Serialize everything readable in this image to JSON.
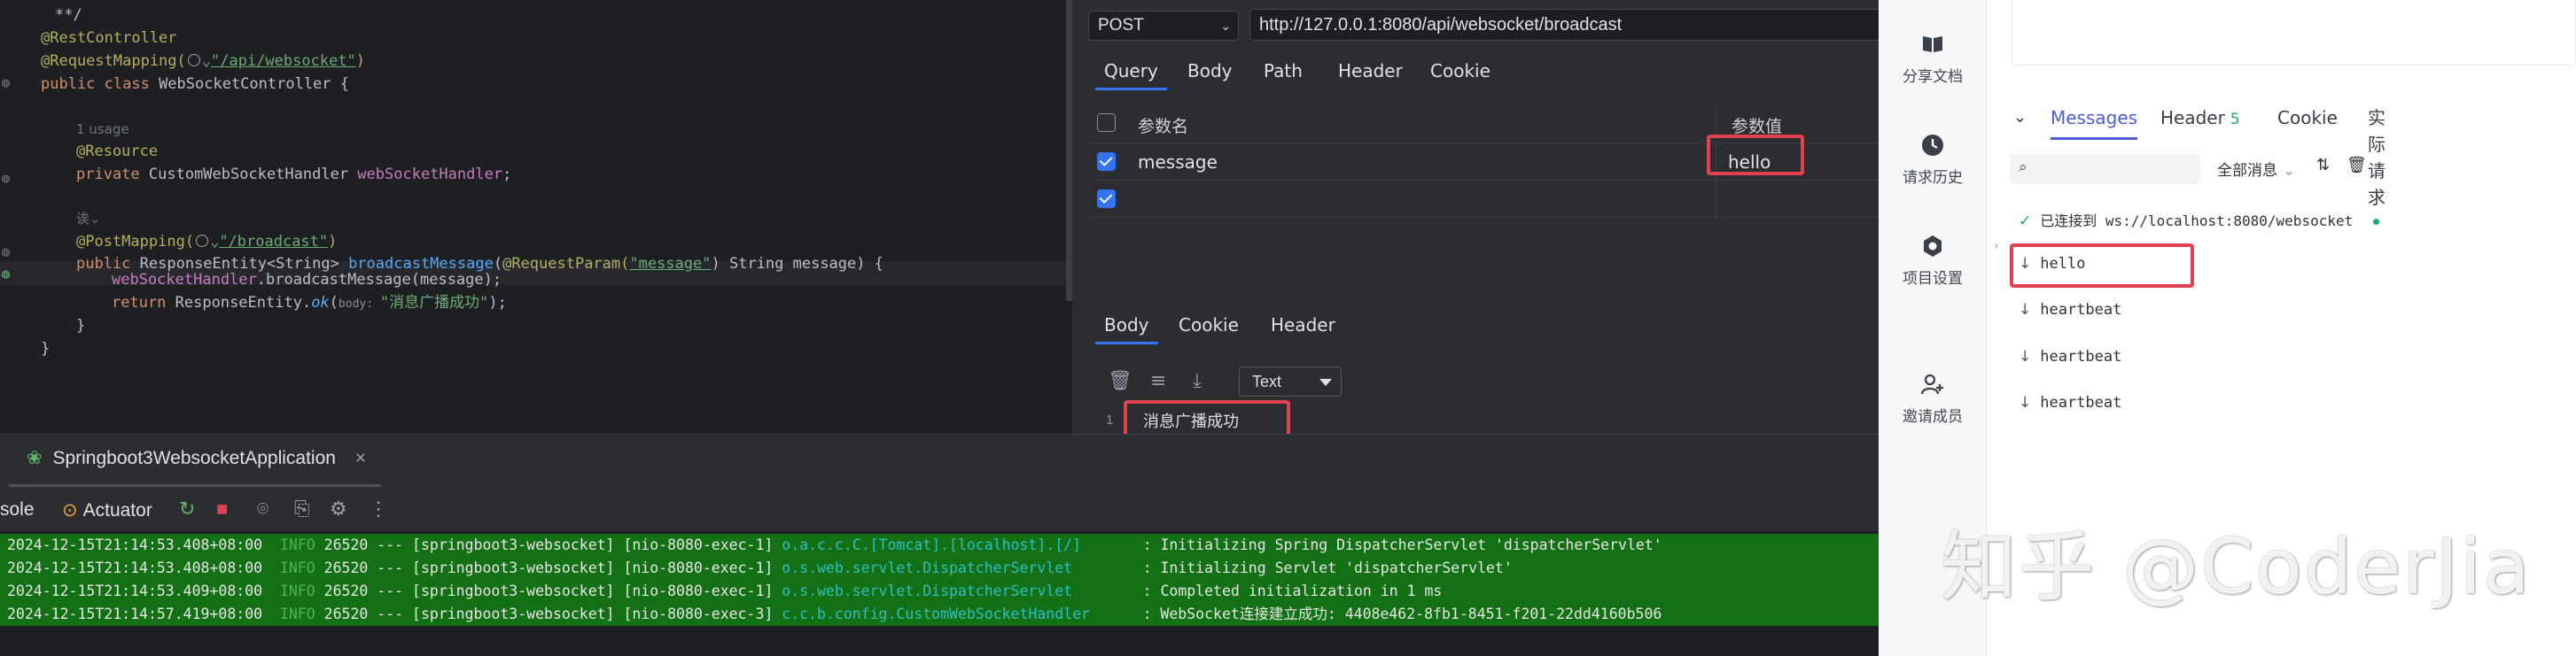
{
  "editor": {
    "lines": {
      "l1": "**/",
      "l2": "@RestController",
      "l3a": "@RequestMapping(",
      "l3b": "\"/api/websocket\"",
      "l3c": ")",
      "l4a": "public class ",
      "l4b": "WebSocketController {",
      "l6": "1 usage",
      "l7": "@Resource",
      "l8a": "private ",
      "l8b": "CustomWebSocketHandler ",
      "l8c": "webSocketHandler",
      "l8d": ";",
      "l10": "诶⌄",
      "l11a": "@PostMapping(",
      "l11b": "\"/broadcast\"",
      "l11c": ")",
      "l12a": "public ",
      "l12b": "ResponseEntity<String> ",
      "l12c": "broadcastMessage",
      "l12d": "(",
      "l12e": "@RequestParam(",
      "l12f": "\"message\"",
      "l12g": ") String message) {",
      "l13a": "webSocketHandler",
      "l13b": ".broadcastMessage(message);",
      "l14a": "return ",
      "l14b": "ResponseEntity.",
      "l14c": "ok",
      "l14d": "(",
      "l14e": "body: ",
      "l14f": "\"消息广播成功\"",
      "l14g": ");",
      "l15": "}",
      "l16": "}"
    }
  },
  "request": {
    "method": "POST",
    "url": "http://127.0.0.1:8080/api/websocket/broadcast",
    "tabs": [
      "Query",
      "Body",
      "Path",
      "Header",
      "Cookie"
    ],
    "params_header": {
      "name": "参数名",
      "value": "参数值"
    },
    "params": [
      {
        "name": "message",
        "value": "hello",
        "checked": true
      }
    ],
    "response_tabs": [
      "Body",
      "Cookie",
      "Header"
    ],
    "response_format": "Text",
    "response_line_no": "1",
    "response_body": "消息广播成功"
  },
  "run": {
    "tab_label": "Springboot3WebsocketApplication",
    "console_label": "sole",
    "actuator_label": "Actuator",
    "logs": [
      {
        "ts": "2024-12-15T21:14:53.408+08:00",
        "level": "INFO",
        "pid": "26520",
        "sep": "---",
        "app": "[springboot3-websocket]",
        "thread": "[nio-8080-exec-1]",
        "logger": "o.a.c.c.C.[Tomcat].[localhost].[/]",
        "msg": ": Initializing Spring DispatcherServlet 'dispatcherServlet'"
      },
      {
        "ts": "2024-12-15T21:14:53.408+08:00",
        "level": "INFO",
        "pid": "26520",
        "sep": "---",
        "app": "[springboot3-websocket]",
        "thread": "[nio-8080-exec-1]",
        "logger": "o.s.web.servlet.DispatcherServlet",
        "msg": ": Initializing Servlet 'dispatcherServlet'"
      },
      {
        "ts": "2024-12-15T21:14:53.409+08:00",
        "level": "INFO",
        "pid": "26520",
        "sep": "---",
        "app": "[springboot3-websocket]",
        "thread": "[nio-8080-exec-1]",
        "logger": "o.s.web.servlet.DispatcherServlet",
        "msg": ": Completed initialization in 1 ms"
      },
      {
        "ts": "2024-12-15T21:14:57.419+08:00",
        "level": "INFO",
        "pid": "26520",
        "sep": "---",
        "app": "[springboot3-websocket]",
        "thread": "[nio-8080-exec-3]",
        "logger": "c.c.b.config.CustomWebSocketHandler",
        "msg": ": WebSocket连接建立成功: 4408e462-8fb1-8451-f201-22dd4160b506"
      }
    ]
  },
  "sidebar": {
    "items": [
      {
        "label": "分享文档",
        "icon": "book-icon"
      },
      {
        "label": "请求历史",
        "icon": "clock-icon"
      },
      {
        "label": "项目设置",
        "icon": "settings-icon"
      },
      {
        "label": "邀请成员",
        "icon": "add-user-icon"
      }
    ]
  },
  "messages": {
    "tabs": [
      {
        "label": "Messages"
      },
      {
        "label": "Header",
        "count": "5"
      },
      {
        "label": "Cookie"
      },
      {
        "label": "实际请求"
      }
    ],
    "filter_label": "全部消息",
    "connected_text": "已连接到 ws://localhost:8080/websocket",
    "items": [
      "hello",
      "heartbeat",
      "heartbeat",
      "heartbeat"
    ]
  },
  "watermark": "知乎 @CoderJia",
  "colors": {
    "accent": "#3574f0",
    "highlight_box": "#e2424f",
    "log_bg": "#147015",
    "ws_tab": "#4f5bd5",
    "success": "#1aab7a"
  }
}
